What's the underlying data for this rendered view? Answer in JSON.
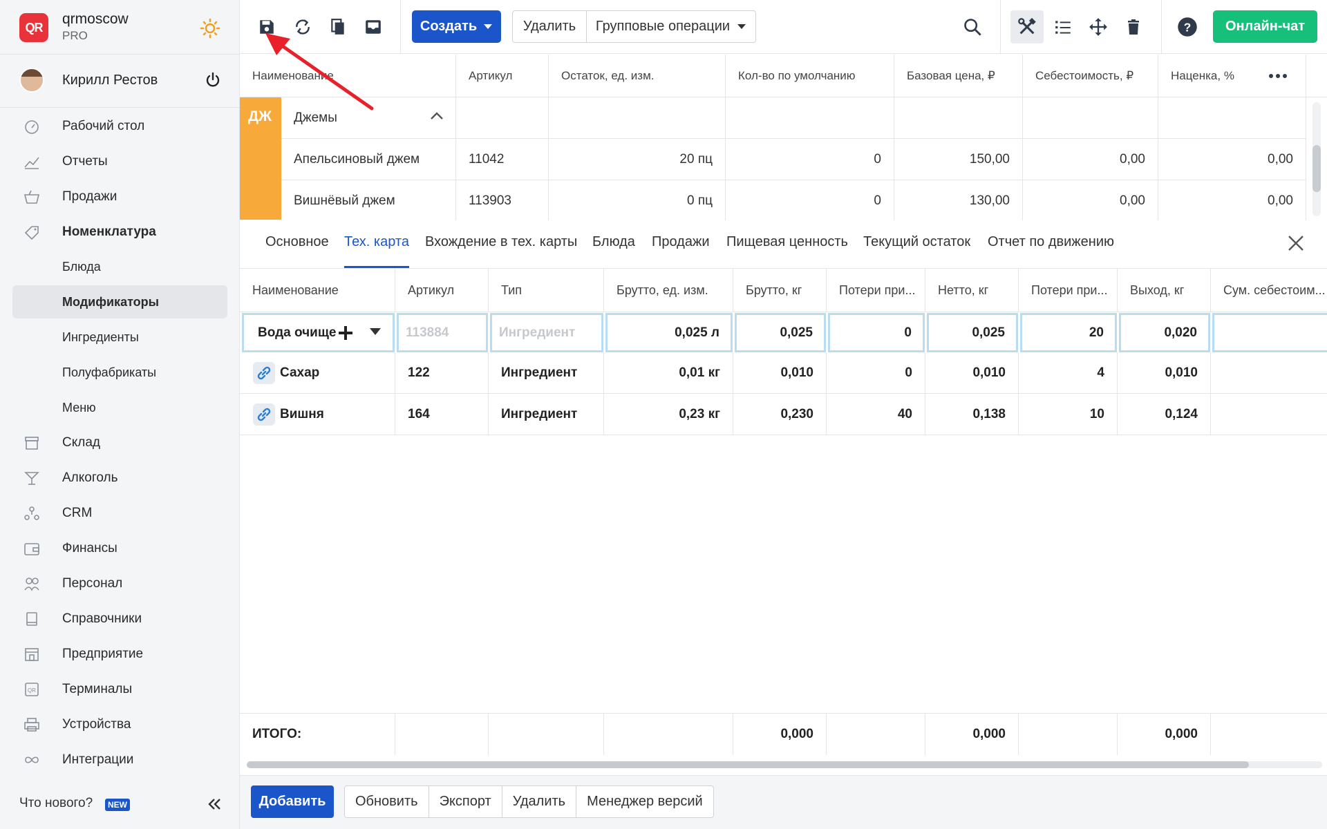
{
  "sidebar": {
    "org_name": "qrmoscow",
    "org_plan": "PRO",
    "logo_text": "QR",
    "user_name": "Кирилл Рестов",
    "items": [
      {
        "label": "Рабочий стол",
        "icon": "dashboard-icon"
      },
      {
        "label": "Отчеты",
        "icon": "chart-icon"
      },
      {
        "label": "Продажи",
        "icon": "basket-icon"
      },
      {
        "label": "Номенклатура",
        "icon": "tag-icon"
      },
      {
        "label": "Блюда"
      },
      {
        "label": "Модификаторы"
      },
      {
        "label": "Ингредиенты"
      },
      {
        "label": "Полуфабрикаты"
      },
      {
        "label": "Меню"
      },
      {
        "label": "Склад",
        "icon": "warehouse-icon"
      },
      {
        "label": "Алкоголь",
        "icon": "cocktail-icon"
      },
      {
        "label": "CRM",
        "icon": "crm-icon"
      },
      {
        "label": "Финансы",
        "icon": "wallet-icon"
      },
      {
        "label": "Персонал",
        "icon": "staff-icon"
      },
      {
        "label": "Справочники",
        "icon": "book-icon"
      },
      {
        "label": "Предприятие",
        "icon": "store-icon"
      },
      {
        "label": "Терминалы",
        "icon": "terminal-icon"
      },
      {
        "label": "Устройства",
        "icon": "printer-icon"
      },
      {
        "label": "Интеграции",
        "icon": "infinity-icon"
      }
    ],
    "whats_new": "Что нового?",
    "new_badge": "NEW"
  },
  "toolbar": {
    "create_label": "Создать",
    "delete_label": "Удалить",
    "group_ops_label": "Групповые операции",
    "chat_label": "Онлайн-чат"
  },
  "top_table": {
    "headers": [
      "Наименование",
      "Артикул",
      "Остаток, ед. изм.",
      "Кол-во по умолчанию",
      "Базовая цена, ₽",
      "Себестоимость, ₽",
      "Наценка, %"
    ],
    "group": {
      "tag": "ДЖ",
      "name": "Джемы"
    },
    "rows": [
      {
        "name": "Апельсиновый джем",
        "sku": "11042",
        "stock": "20 пц",
        "default_qty": "0",
        "base_price": "150,00",
        "cost": "0,00",
        "markup": "0,00"
      },
      {
        "name": "Вишнёвый джем",
        "sku": "113903",
        "stock": "0 пц",
        "default_qty": "0",
        "base_price": "130,00",
        "cost": "0,00",
        "markup": "0,00"
      }
    ]
  },
  "tabs": [
    "Основное",
    "Тех. карта",
    "Вхождение в тех. карты",
    "Блюда",
    "Продажи",
    "Пищевая ценность",
    "Текущий остаток",
    "Отчет по движению"
  ],
  "active_tab": "Тех. карта",
  "tech_card": {
    "headers": [
      "Наименование",
      "Артикул",
      "Тип",
      "Брутто, ед. изм.",
      "Брутто, кг",
      "Потери при...",
      "Нетто, кг",
      "Потери при...",
      "Выход, кг",
      "Сум. себестоим..."
    ],
    "edit_row": {
      "name": "Вода очище",
      "sku_placeholder": "113884",
      "type_placeholder": "Ингредиент",
      "gross_unit": "0,025 л",
      "gross_kg": "0,025",
      "loss1": "0",
      "net_kg": "0,025",
      "loss2": "20",
      "yield_kg": "0,020"
    },
    "rows": [
      {
        "name": "Сахар",
        "sku": "122",
        "type": "Ингредиент",
        "gross_unit": "0,01 кг",
        "gross_kg": "0,010",
        "loss1": "0",
        "net_kg": "0,010",
        "loss2": "4",
        "yield_kg": "0,010"
      },
      {
        "name": "Вишня",
        "sku": "164",
        "type": "Ингредиент",
        "gross_unit": "0,23 кг",
        "gross_kg": "0,230",
        "loss1": "40",
        "net_kg": "0,138",
        "loss2": "10",
        "yield_kg": "0,124"
      }
    ],
    "totals": {
      "label": "ИТОГО:",
      "gross_kg": "0,000",
      "net_kg": "0,000",
      "yield_kg": "0,000"
    }
  },
  "bottom": {
    "add_label": "Добавить",
    "buttons": [
      "Обновить",
      "Экспорт",
      "Удалить",
      "Менеджер версий"
    ]
  },
  "colors": {
    "accent": "#1a56c9",
    "chat": "#17c07a",
    "group_tag": "#f7a93a",
    "annotation_arrow": "#e8202a"
  }
}
